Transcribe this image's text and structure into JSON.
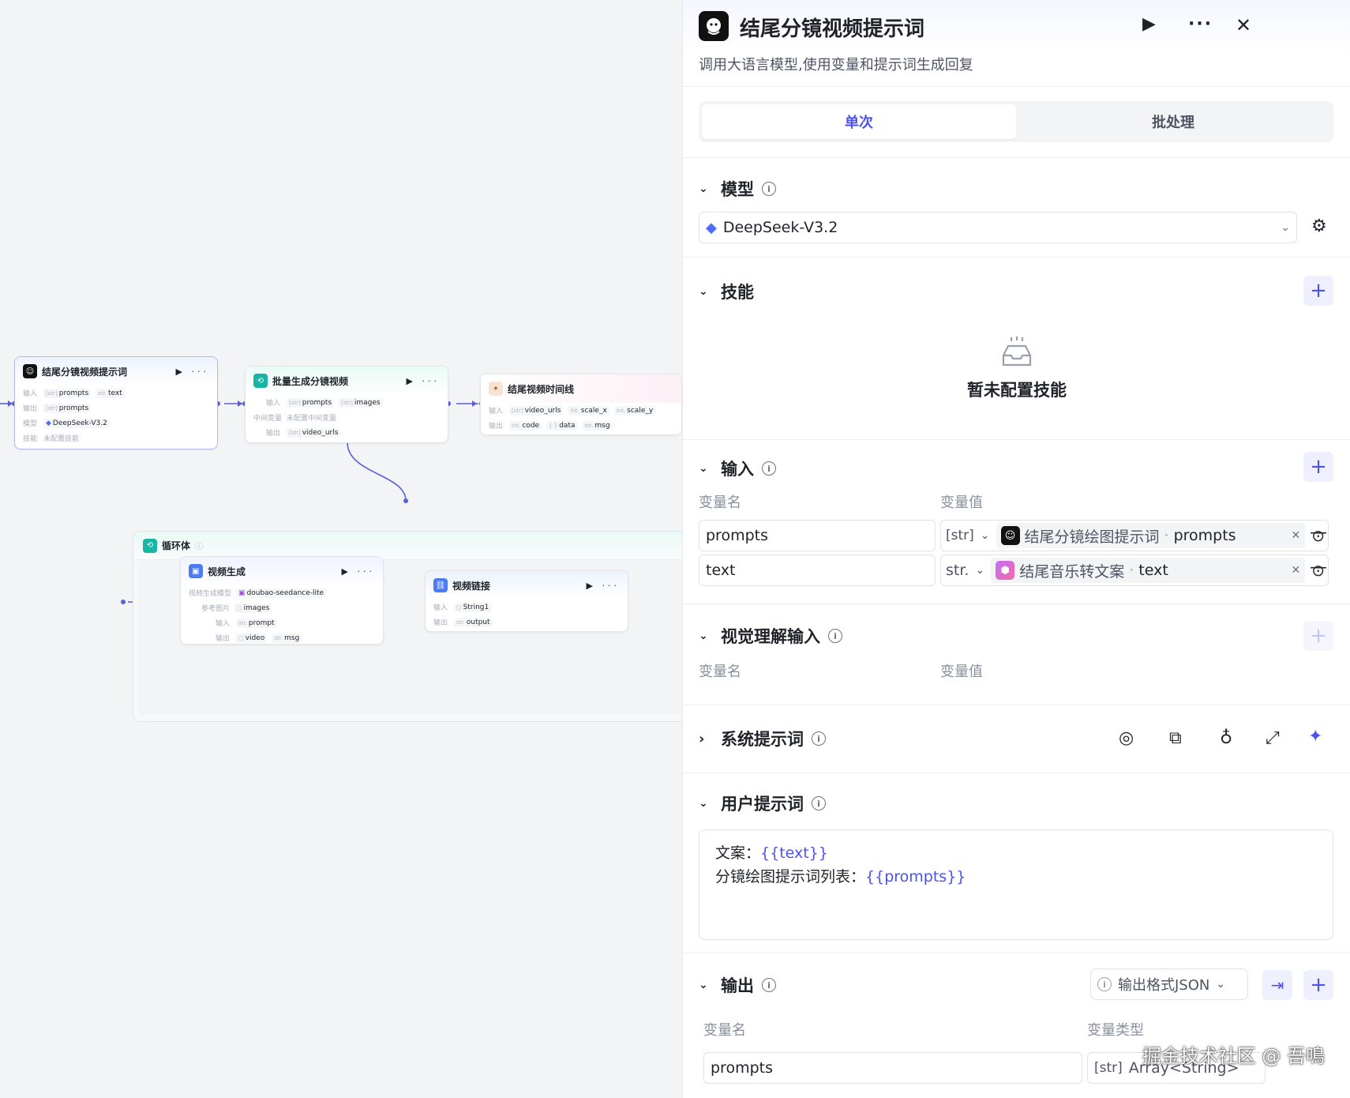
{
  "canvas": {
    "node1": {
      "title": "结尾分镜视频提示词",
      "in_label": "输入",
      "in1": "prompts",
      "in2": "text",
      "out_label": "输出",
      "out1": "prompts",
      "model_label": "模型",
      "model": "DeepSeek-V3.2",
      "skill_label": "技能",
      "skill": "未配置技能"
    },
    "node2": {
      "title": "批量生成分镜视频",
      "in_label": "输入",
      "in1": "prompts",
      "in2": "images",
      "mid_label": "中间变量",
      "mid": "未配置中间变量",
      "out_label": "输出",
      "out1": "video_urls"
    },
    "node3": {
      "title": "结尾视频时间线",
      "in_label": "输入",
      "in1": "video_urls",
      "in2": "scale_x",
      "in3": "scale_y",
      "out_label": "输出",
      "out1": "code",
      "out2": "data",
      "out3": "msg"
    },
    "loop": {
      "title": "循环体"
    },
    "node4": {
      "title": "视频生成",
      "model_label": "视频生成模型",
      "model": "doubao-seedance-lite",
      "ref_label": "参考图片",
      "ref": "images",
      "in_label": "输入",
      "in1": "prompt",
      "out_label": "输出",
      "out1": "video",
      "out2": "msg"
    },
    "node5": {
      "title": "视频链接",
      "in_label": "输入",
      "in1": "String1",
      "out_label": "输出",
      "out1": "output"
    }
  },
  "panel": {
    "title": "结尾分镜视频提示词",
    "description": "调用大语言模型,使用变量和提示词生成回复",
    "tabs": [
      {
        "label": "单次"
      },
      {
        "label": "批处理"
      }
    ],
    "model": {
      "label": "模型",
      "selected": "DeepSeek-V3.2"
    },
    "skills": {
      "label": "技能",
      "empty": "暂未配置技能"
    },
    "inputs": {
      "label": "输入",
      "col_name": "变量名",
      "col_value": "变量值",
      "rows": [
        {
          "name": "prompts",
          "type": "[str]",
          "source": "结尾分镜绘图提示词",
          "field": "prompts"
        },
        {
          "name": "text",
          "type": "str.",
          "source": "结尾音乐转文案",
          "field": "text"
        }
      ]
    },
    "vision": {
      "label": "视觉理解输入",
      "col_name": "变量名",
      "col_value": "变量值"
    },
    "system_prompt": {
      "label": "系统提示词"
    },
    "user_prompt": {
      "label": "用户提示词",
      "line1_prefix": "文案：",
      "line1_var": "{{text}}",
      "line2_prefix": "分镜绘图提示词列表：",
      "line2_var": "{{prompts}}"
    },
    "output": {
      "label": "输出",
      "format": "输出格式JSON",
      "col_name": "变量名",
      "col_type": "变量类型",
      "rows": [
        {
          "name": "prompts",
          "type_prefix": "[str]",
          "type": "Array<String>"
        }
      ]
    }
  },
  "watermark": "掘金技术社区 @ 吾鳴",
  "colors": {
    "accent": "#4d53e8",
    "node_edge": "#5b5fd6"
  }
}
